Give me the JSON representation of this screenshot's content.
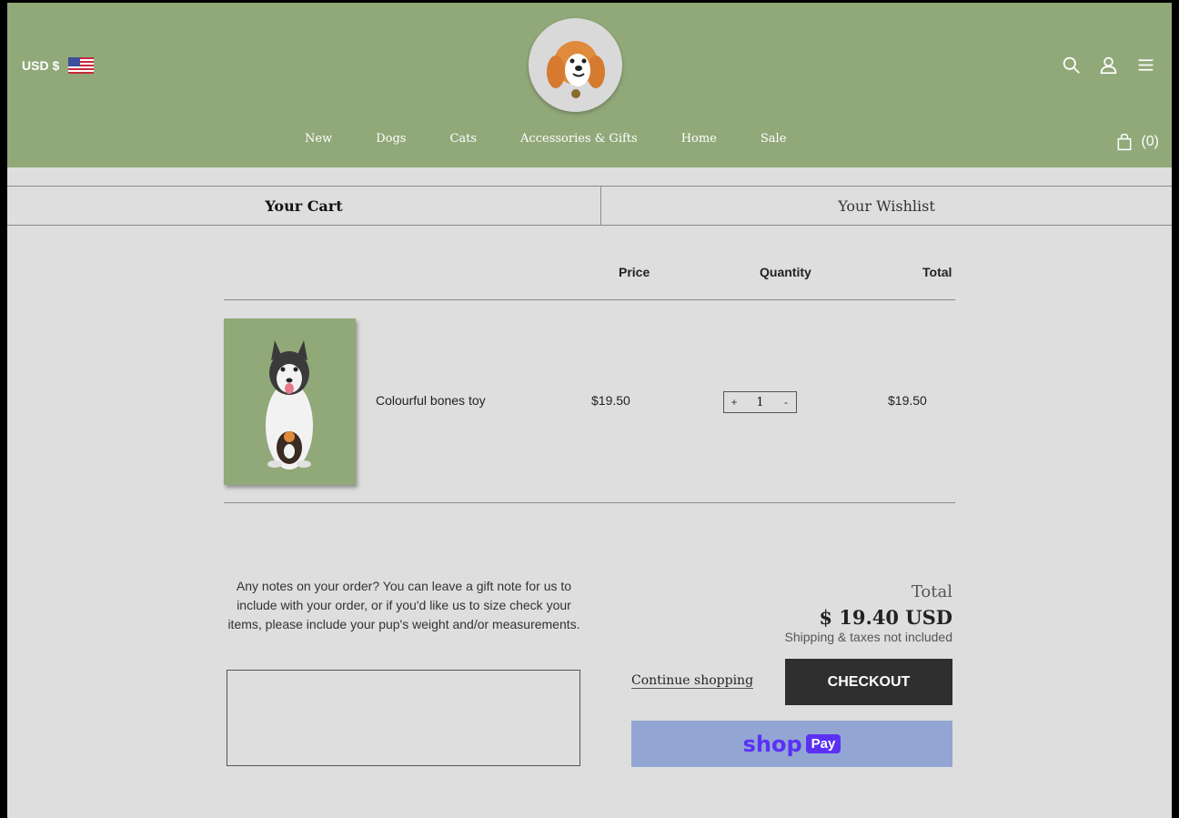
{
  "header": {
    "currency": "USD $",
    "flag_icon": "us-flag-icon",
    "logo_icon": "beagle-dog-logo-icon",
    "icons": [
      "search-icon",
      "user-icon",
      "menu-icon"
    ],
    "cart_count": "(0)",
    "nav": [
      "New",
      "Dogs",
      "Cats",
      "Accessories & Gifts",
      "Home",
      "Sale"
    ]
  },
  "tabs": {
    "cart": "Your Cart",
    "wishlist": "Your Wishlist"
  },
  "cart_table": {
    "headers": {
      "price": "Price",
      "quantity": "Quantity",
      "total": "Total"
    },
    "items": [
      {
        "name": "Colourful bones toy",
        "image": "husky-with-toy-image",
        "price": "$19.50",
        "quantity": "1",
        "total": "$19.50"
      }
    ],
    "qty_plus": "+",
    "qty_minus": "-"
  },
  "notes": {
    "label": "Any notes on your order? You can leave a gift note for us to include with your order, or if you'd like us to size check your items, please include your pup's weight and/or measurements.",
    "value": ""
  },
  "summary": {
    "total_label": "Total",
    "total_amount": "$ 19.40 USD",
    "note": "Shipping & taxes not included",
    "continue": "Continue shopping",
    "checkout": "CHECKOUT",
    "shoppay_word": "shop",
    "shoppay_pay": "Pay"
  },
  "colors": {
    "header_bg": "#91a879",
    "page_bg": "#dedede",
    "checkout_bg": "#2f2f2f",
    "shoppay_bg": "#93a5d3",
    "shoppay_brand": "#5a31f4"
  }
}
